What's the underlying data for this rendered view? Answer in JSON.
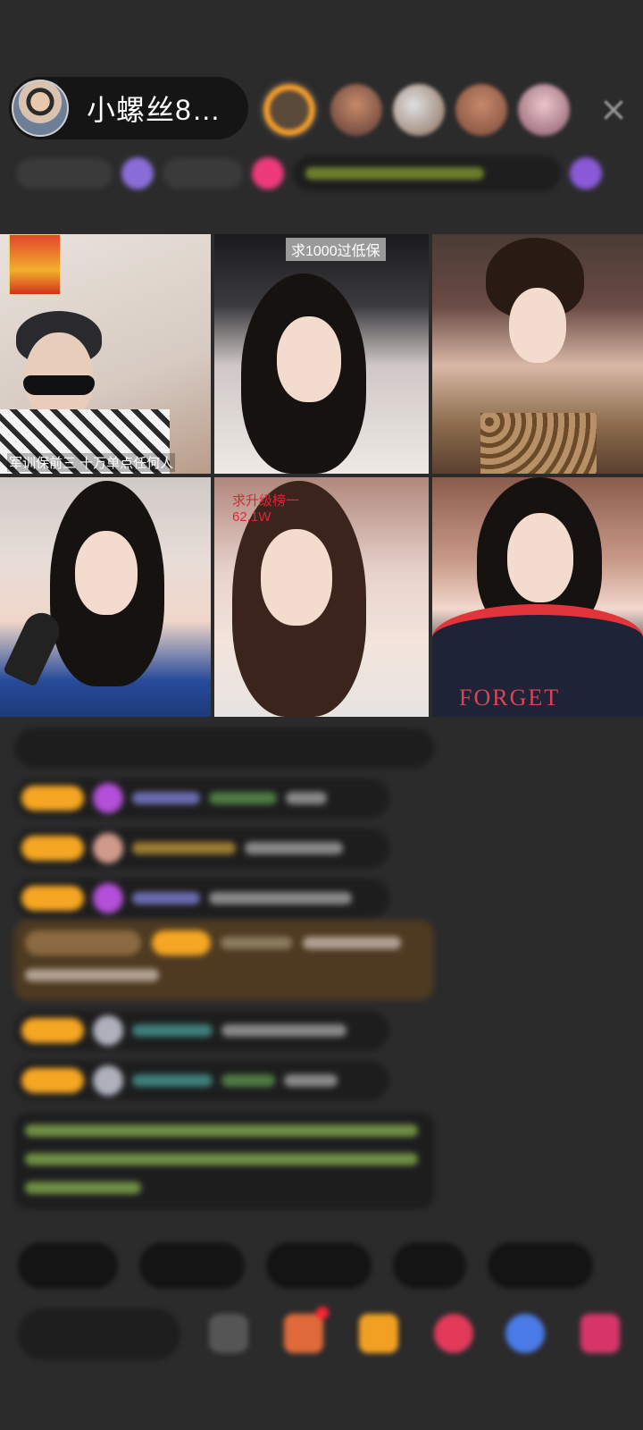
{
  "header": {
    "host_name": "小螺丝8…",
    "close_icon": "×"
  },
  "grid": {
    "tiles": [
      {
        "caption": "军训保前三  十万单点任何人"
      },
      {
        "caption": "求1000过低保"
      },
      {
        "caption": ""
      },
      {
        "caption": ""
      },
      {
        "caption": "求升级榜一\n62.1W"
      },
      {
        "caption": "FORGET"
      }
    ]
  },
  "colors": {
    "background": "#2b2b2c",
    "badge": "#f5a623",
    "gift_row": "#4d3a21",
    "alert_red": "#e0253a"
  },
  "icons": [
    "close-icon",
    "gift-icon",
    "share-icon",
    "more-icon"
  ]
}
